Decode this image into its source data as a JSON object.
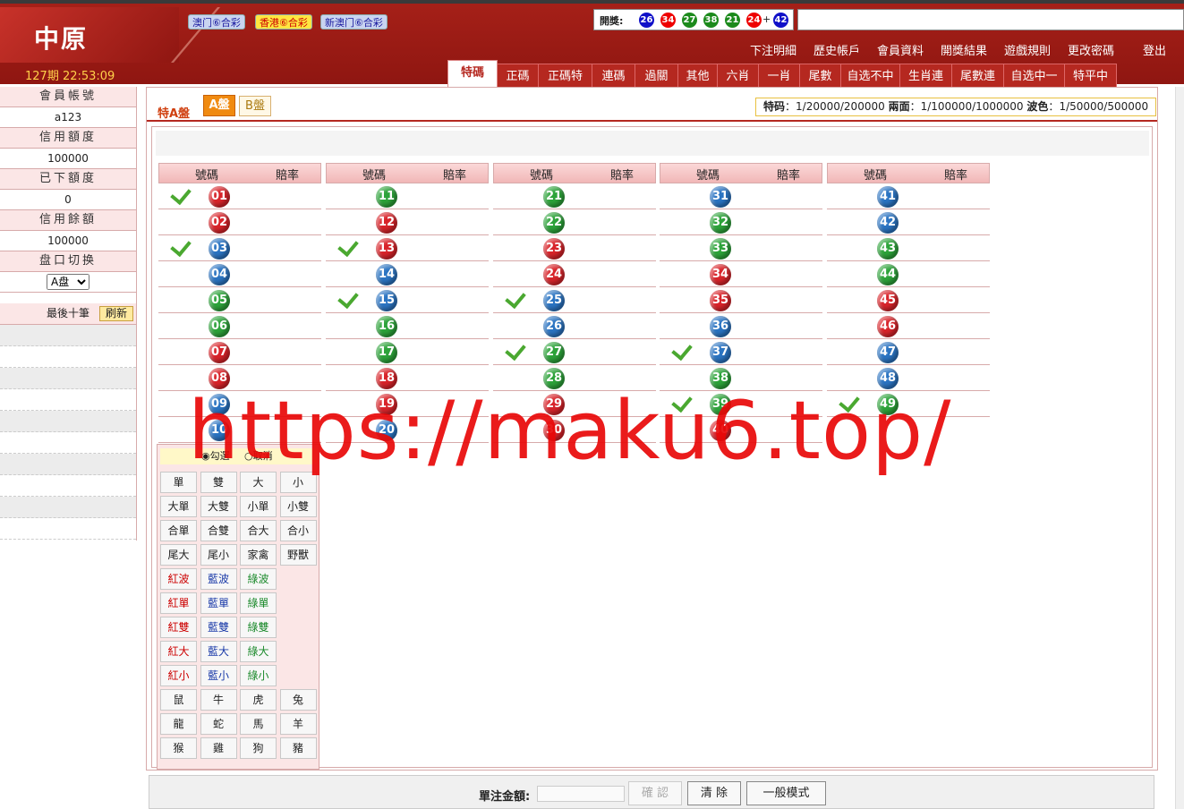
{
  "header": {
    "logo": "中原",
    "period": "127期 22:53:09",
    "lottery_tags": [
      "澳门⑥合彩",
      "香港⑥合彩",
      "新澳门⑥合彩"
    ],
    "draw_label": "開獎:",
    "draw_balls": [
      {
        "n": "26",
        "c": "blue"
      },
      {
        "n": "34",
        "c": "red"
      },
      {
        "n": "27",
        "c": "green"
      },
      {
        "n": "38",
        "c": "green"
      },
      {
        "n": "21",
        "c": "green"
      },
      {
        "n": "24",
        "c": "red"
      },
      {
        "n": "42",
        "c": "blue"
      }
    ],
    "plus": "+"
  },
  "topnav": [
    "下注明細",
    "歷史帳戶",
    "會員資料",
    "開獎結果",
    "遊戲規則",
    "更改密碼",
    "登出"
  ],
  "tabs": [
    "特碼",
    "正碼",
    "正碼特",
    "連碼",
    "過關",
    "其他",
    "六肖",
    "一肖",
    "尾數",
    "自选不中",
    "生肖連",
    "尾數連",
    "自选中一",
    "特平中"
  ],
  "sidebar": {
    "member_account_label": "會員帳號",
    "member_account": "a123",
    "credit_label": "信用額度",
    "credit": "100000",
    "used_label": "已下額度",
    "used": "0",
    "balance_label": "信用餘額",
    "balance": "100000",
    "switch_label": "盘口切换",
    "switch_value": "A盘",
    "last10_label": "最後十筆",
    "refresh": "刷新"
  },
  "main": {
    "title": "特A盤",
    "btn_a": "A盤",
    "btn_b": "B盤",
    "odds": [
      {
        "k": "特码",
        "v": "1/20000/200000"
      },
      {
        "k": "兩面",
        "v": "1/100000/1000000"
      },
      {
        "k": "波色",
        "v": "1/50000/500000"
      }
    ],
    "col_h_num": "號碼",
    "col_h_rate": "賠率",
    "numbers": [
      [
        {
          "n": "01",
          "c": "red",
          "chk": true
        },
        {
          "n": "02",
          "c": "red"
        },
        {
          "n": "03",
          "c": "blue",
          "chk": true
        },
        {
          "n": "04",
          "c": "blue"
        },
        {
          "n": "05",
          "c": "green"
        },
        {
          "n": "06",
          "c": "green"
        },
        {
          "n": "07",
          "c": "red"
        },
        {
          "n": "08",
          "c": "red"
        },
        {
          "n": "09",
          "c": "blue"
        },
        {
          "n": "10",
          "c": "blue"
        }
      ],
      [
        {
          "n": "11",
          "c": "green"
        },
        {
          "n": "12",
          "c": "red"
        },
        {
          "n": "13",
          "c": "red",
          "chk": true
        },
        {
          "n": "14",
          "c": "blue"
        },
        {
          "n": "15",
          "c": "blue",
          "chk": true
        },
        {
          "n": "16",
          "c": "green"
        },
        {
          "n": "17",
          "c": "green"
        },
        {
          "n": "18",
          "c": "red"
        },
        {
          "n": "19",
          "c": "red"
        },
        {
          "n": "20",
          "c": "blue"
        }
      ],
      [
        {
          "n": "21",
          "c": "green"
        },
        {
          "n": "22",
          "c": "green"
        },
        {
          "n": "23",
          "c": "red"
        },
        {
          "n": "24",
          "c": "red"
        },
        {
          "n": "25",
          "c": "blue",
          "chk": true
        },
        {
          "n": "26",
          "c": "blue"
        },
        {
          "n": "27",
          "c": "green",
          "chk": true
        },
        {
          "n": "28",
          "c": "green"
        },
        {
          "n": "29",
          "c": "red"
        },
        {
          "n": "30",
          "c": "red"
        }
      ],
      [
        {
          "n": "31",
          "c": "blue"
        },
        {
          "n": "32",
          "c": "green"
        },
        {
          "n": "33",
          "c": "green"
        },
        {
          "n": "34",
          "c": "red"
        },
        {
          "n": "35",
          "c": "red"
        },
        {
          "n": "36",
          "c": "blue"
        },
        {
          "n": "37",
          "c": "blue",
          "chk": true
        },
        {
          "n": "38",
          "c": "green"
        },
        {
          "n": "39",
          "c": "green",
          "chk": true
        },
        {
          "n": "40",
          "c": "red"
        }
      ],
      [
        {
          "n": "41",
          "c": "blue"
        },
        {
          "n": "42",
          "c": "blue"
        },
        {
          "n": "43",
          "c": "green"
        },
        {
          "n": "44",
          "c": "green"
        },
        {
          "n": "45",
          "c": "red"
        },
        {
          "n": "46",
          "c": "red"
        },
        {
          "n": "47",
          "c": "blue"
        },
        {
          "n": "48",
          "c": "blue"
        },
        {
          "n": "49",
          "c": "green",
          "chk": true
        }
      ]
    ],
    "quick": {
      "radio1": "勾選",
      "radio2": "取消",
      "rows": [
        [
          {
            "t": "單"
          },
          {
            "t": "雙"
          },
          {
            "t": "大"
          },
          {
            "t": "小"
          }
        ],
        [
          {
            "t": "大單"
          },
          {
            "t": "大雙"
          },
          {
            "t": "小單"
          },
          {
            "t": "小雙"
          }
        ],
        [
          {
            "t": "合單"
          },
          {
            "t": "合雙"
          },
          {
            "t": "合大"
          },
          {
            "t": "合小"
          }
        ],
        [
          {
            "t": "尾大"
          },
          {
            "t": "尾小"
          },
          {
            "t": "家禽"
          },
          {
            "t": "野獸"
          }
        ],
        [
          {
            "t": "紅波",
            "c": "r"
          },
          {
            "t": "藍波",
            "c": "b"
          },
          {
            "t": "綠波",
            "c": "g"
          }
        ],
        [
          {
            "t": "紅單",
            "c": "r"
          },
          {
            "t": "藍單",
            "c": "b"
          },
          {
            "t": "綠單",
            "c": "g"
          }
        ],
        [
          {
            "t": "紅雙",
            "c": "r"
          },
          {
            "t": "藍雙",
            "c": "b"
          },
          {
            "t": "綠雙",
            "c": "g"
          }
        ],
        [
          {
            "t": "紅大",
            "c": "r"
          },
          {
            "t": "藍大",
            "c": "b"
          },
          {
            "t": "綠大",
            "c": "g"
          }
        ],
        [
          {
            "t": "紅小",
            "c": "r"
          },
          {
            "t": "藍小",
            "c": "b"
          },
          {
            "t": "綠小",
            "c": "g"
          }
        ],
        [
          {
            "t": "鼠"
          },
          {
            "t": "牛"
          },
          {
            "t": "虎"
          },
          {
            "t": "兔"
          }
        ],
        [
          {
            "t": "龍"
          },
          {
            "t": "蛇"
          },
          {
            "t": "馬"
          },
          {
            "t": "羊"
          }
        ],
        [
          {
            "t": "猴"
          },
          {
            "t": "雞"
          },
          {
            "t": "狗"
          },
          {
            "t": "豬"
          }
        ]
      ]
    }
  },
  "footer": {
    "amount_label": "單注金額:",
    "confirm": "確 認",
    "clear": "清 除",
    "mode": "一般模式"
  },
  "watermark": "https://maku6.top/"
}
